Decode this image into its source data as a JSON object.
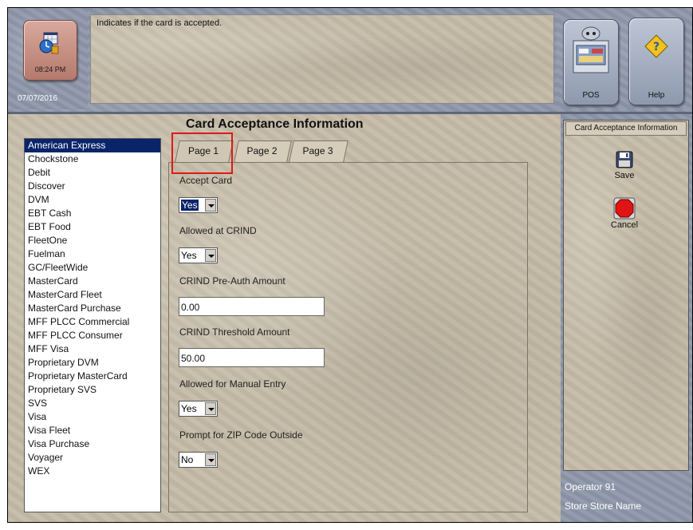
{
  "header": {
    "time": "08:24 PM",
    "date": "07/07/2016",
    "prompt": "Indicates if the card is accepted."
  },
  "top_buttons": {
    "pos_label": "POS",
    "help_label": "Help"
  },
  "main": {
    "title": "Card Acceptance Information",
    "tabs": [
      {
        "label": "Page 1",
        "active": true
      },
      {
        "label": "Page 2",
        "active": false
      },
      {
        "label": "Page 3",
        "active": false
      }
    ],
    "fields": {
      "accept_card": {
        "label": "Accept Card",
        "value": "Yes"
      },
      "allowed_crind": {
        "label": "Allowed at CRIND",
        "value": "Yes"
      },
      "preauth_amount": {
        "label": "CRIND Pre-Auth Amount",
        "value": "0.00"
      },
      "threshold_amount": {
        "label": "CRIND Threshold Amount",
        "value": "50.00"
      },
      "manual_entry": {
        "label": "Allowed for Manual Entry",
        "value": "Yes"
      },
      "zip_prompt": {
        "label": "Prompt for ZIP Code Outside",
        "value": "No"
      }
    }
  },
  "card_list": {
    "selected": "American Express",
    "items": [
      "American Express",
      "Chockstone",
      "Debit",
      "Discover",
      "DVM",
      "EBT Cash",
      "EBT Food",
      "FleetOne",
      "Fuelman",
      "GC/FleetWide",
      "MasterCard",
      "MasterCard Fleet",
      "MasterCard Purchase",
      "MFF PLCC Commercial",
      "MFF PLCC Consumer",
      "MFF Visa",
      "Proprietary DVM",
      "Proprietary MasterCard",
      "Proprietary SVS",
      "SVS",
      "Visa",
      "Visa Fleet",
      "Visa Purchase",
      "Voyager",
      "WEX"
    ]
  },
  "side_panel": {
    "title": "Card Acceptance Information",
    "save_label": "Save",
    "cancel_label": "Cancel"
  },
  "footer": {
    "operator": "Operator 91",
    "store": "Store Store Name"
  },
  "colors": {
    "selection": "#0a246a",
    "highlight_box": "#e01818",
    "panel_bg": "#c4baa6",
    "chrome_bg": "#8e97aa"
  },
  "icons": {
    "clock": "clock-calendar-icon",
    "pos": "pos-terminal-icon",
    "help": "help-icon",
    "save": "floppy-disk-icon",
    "cancel": "stop-icon"
  }
}
